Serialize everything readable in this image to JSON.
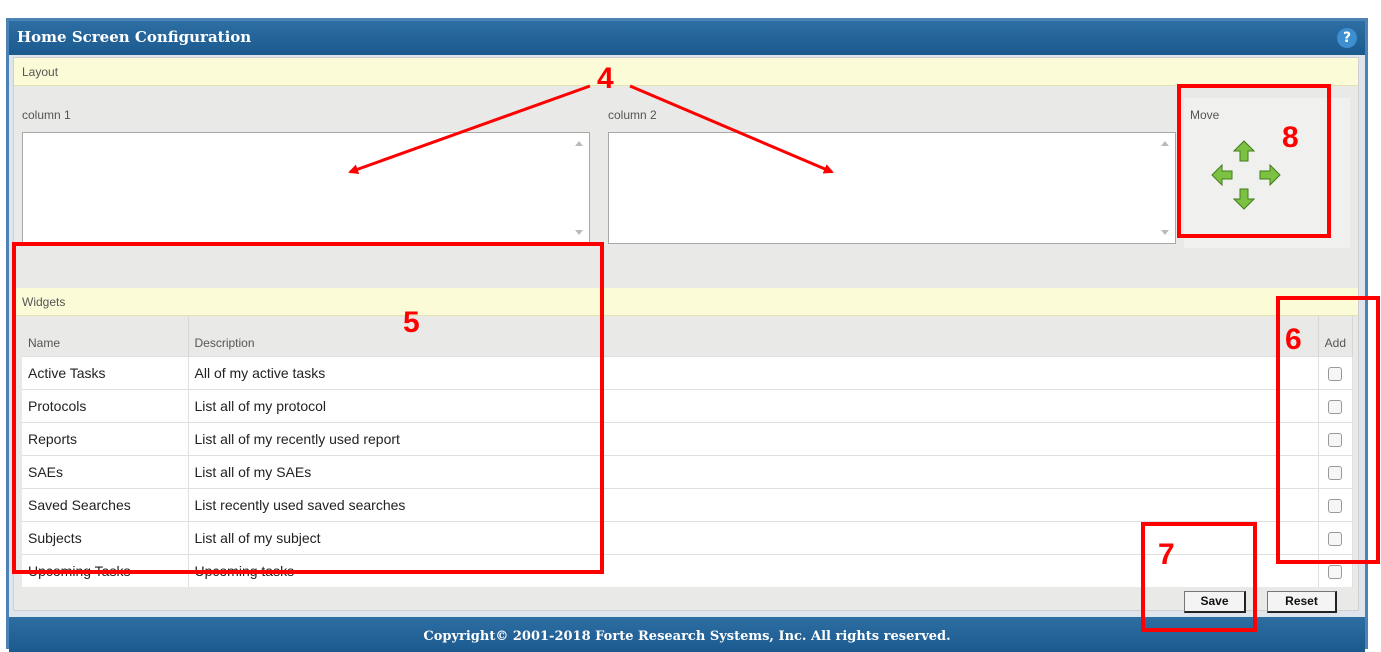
{
  "window": {
    "title": "Home Screen Configuration",
    "help_label": "?"
  },
  "layout": {
    "section_label": "Layout",
    "column1_label": "column 1",
    "column2_label": "column 2",
    "move_label": "Move"
  },
  "widgets": {
    "section_label": "Widgets",
    "headers": {
      "name": "Name",
      "description": "Description",
      "add": "Add"
    },
    "rows": [
      {
        "name": "Active Tasks",
        "description": "All of my active tasks"
      },
      {
        "name": "Protocols",
        "description": "List all of my protocol"
      },
      {
        "name": "Reports",
        "description": "List all of my recently used report"
      },
      {
        "name": "SAEs",
        "description": "List all of my SAEs"
      },
      {
        "name": "Saved Searches",
        "description": "List recently used saved searches"
      },
      {
        "name": "Subjects",
        "description": "List all of my subject"
      },
      {
        "name": "Upcoming Tasks",
        "description": "Upcoming tasks"
      }
    ]
  },
  "buttons": {
    "save": "Save",
    "reset": "Reset"
  },
  "footer": {
    "copyright": "Copyright© 2001-2018 Forte Research Systems, Inc. All rights reserved."
  },
  "annotations": {
    "callout_4": "4",
    "callout_5": "5",
    "callout_6": "6",
    "callout_7": "7",
    "callout_8": "8",
    "color": "#ff0000"
  },
  "colors": {
    "header_blue": "#1b5a8f",
    "section_yellow": "#fcfbd8",
    "arrow_green": "#6bb52d"
  },
  "icons": [
    "arrow-up-icon",
    "arrow-left-icon",
    "arrow-right-icon",
    "arrow-down-icon",
    "help-icon"
  ]
}
